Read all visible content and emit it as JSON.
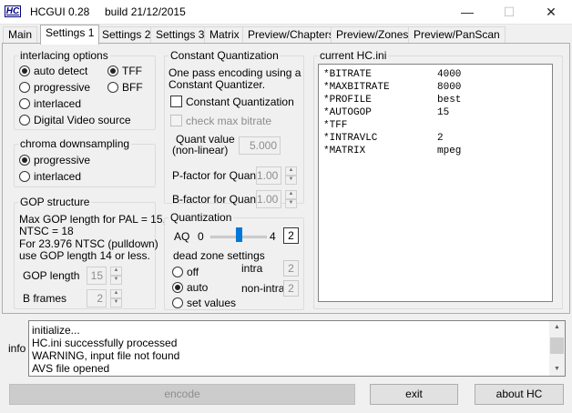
{
  "app": {
    "logo": "HC",
    "title": "HCGUI 0.28",
    "build": "build 21/12/2015",
    "window_buttons": {
      "minimize": "—",
      "maximize": "☐",
      "close": "✕"
    }
  },
  "tabs": [
    {
      "label": "Main"
    },
    {
      "label": "Settings 1"
    },
    {
      "label": "Settings 2"
    },
    {
      "label": "Settings 3"
    },
    {
      "label": "Matrix"
    },
    {
      "label": "Preview/Chapters"
    },
    {
      "label": "Preview/Zones"
    },
    {
      "label": "Preview/PanScan"
    }
  ],
  "active_tab": "Settings 1",
  "interlacing": {
    "title": "interlacing options",
    "options": [
      "auto detect",
      "progressive",
      "interlaced",
      "Digital Video source"
    ],
    "selected": "auto detect",
    "field_order": [
      "TFF",
      "BFF"
    ],
    "field_order_selected": "TFF"
  },
  "chroma": {
    "title": "chroma downsampling",
    "options": [
      "progressive",
      "interlaced"
    ],
    "selected": "progressive"
  },
  "gop": {
    "title": "GOP structure",
    "note_lines": [
      "Max GOP length for PAL = 15,",
      "NTSC = 18",
      "For 23.976 NTSC (pulldown)",
      "use GOP length 14 or less."
    ],
    "gop_length_label": "GOP length",
    "gop_length_value": "15",
    "b_frames_label": "B frames",
    "b_frames_value": "2"
  },
  "constant_quant": {
    "title": "Constant Quantization",
    "desc_lines": [
      "One pass encoding using a",
      "Constant Quantizer."
    ],
    "enable_label": "Constant Quantization",
    "enable_checked": false,
    "max_bitrate_label": "check max bitrate",
    "max_bitrate_checked": false,
    "quant_value_label_lines": [
      "Quant value",
      "(non-linear)"
    ],
    "quant_value": "5.000",
    "p_factor_label": "P-factor for Quant",
    "p_factor_value": "1.00",
    "b_factor_label": "B-factor for Quant",
    "b_factor_value": "1.00"
  },
  "quantization": {
    "title": "Quantization",
    "aq_label": "AQ",
    "aq_min": "0",
    "aq_max": "4",
    "aq_value": "2",
    "aq_fraction": 0.5,
    "dead_zone_title": "dead zone settings",
    "dead_zone_options": [
      "off",
      "auto",
      "set values"
    ],
    "dead_zone_selected": "auto",
    "intra_label": "intra",
    "intra_value": "2",
    "nonintra_label": "non-intra",
    "nonintra_value": "2"
  },
  "current_ini": {
    "title": "current HC.ini",
    "entries": [
      {
        "key": "*BITRATE",
        "value": "4000"
      },
      {
        "key": "*MAXBITRATE",
        "value": "8000"
      },
      {
        "key": "*PROFILE",
        "value": "best"
      },
      {
        "key": "*AUTOGOP",
        "value": "15"
      },
      {
        "key": "*TFF",
        "value": ""
      },
      {
        "key": "*INTRAVLC",
        "value": "2"
      },
      {
        "key": "*MATRIX",
        "value": "mpeg"
      }
    ]
  },
  "info": {
    "label": "info",
    "lines": [
      "initialize...",
      "HC.ini successfully processed",
      "WARNING, input file not found",
      "AVS file opened"
    ]
  },
  "buttons": {
    "encode": "encode",
    "exit": "exit",
    "about": "about HC"
  }
}
